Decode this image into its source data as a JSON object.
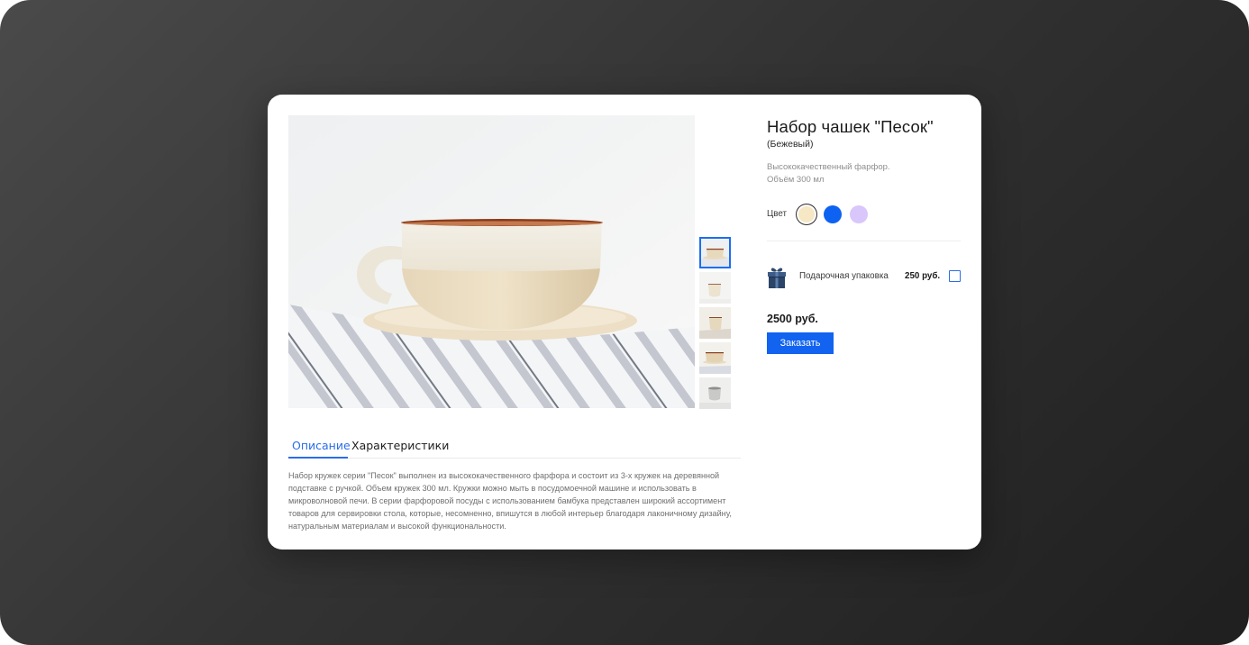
{
  "product": {
    "title": "Набор чашек \"Песок\"",
    "variant": "(Бежевый)",
    "specs": [
      "Высококачественный фарфор.",
      "Объём 300 мл"
    ],
    "color_label": "Цвет",
    "colors": [
      {
        "name": "beige",
        "hex": "#f6e8c4",
        "selected": true
      },
      {
        "name": "blue",
        "hex": "#0d62f2",
        "selected": false
      },
      {
        "name": "lavender",
        "hex": "#d9c6fb",
        "selected": false
      }
    ],
    "gift": {
      "label": "Подарочная упаковка",
      "price": "250 руб.",
      "checked": false,
      "icon": "gift-box-icon"
    },
    "price": "2500 руб.",
    "order_button": "Заказать"
  },
  "gallery": {
    "thumbnails": [
      {
        "name": "cup-side-view",
        "selected": true
      },
      {
        "name": "cup-front-view",
        "selected": false
      },
      {
        "name": "cup-on-fabric",
        "selected": false
      },
      {
        "name": "cups-stack",
        "selected": false
      },
      {
        "name": "cup-grey",
        "selected": false
      }
    ]
  },
  "tabs": [
    {
      "label": "Описание",
      "active": true
    },
    {
      "label": "Характеристики",
      "active": false
    }
  ],
  "description": "Набор кружек серии \"Песок\" выполнен из высококачественного фарфора и состоит из 3-х кружек на деревянной подставке с ручкой. Объем кружек 300 мл. Кружки можно мыть в посудомоечной машине и использовать в микроволновой печи. В серии фарфоровой посуды с использованием бамбука представлен широкий ассортимент товаров для сервировки стола, которые, несомненно, впишутся в любой интерьер благодаря лаконичному дизайну, натуральным материалам и высокой функциональности."
}
